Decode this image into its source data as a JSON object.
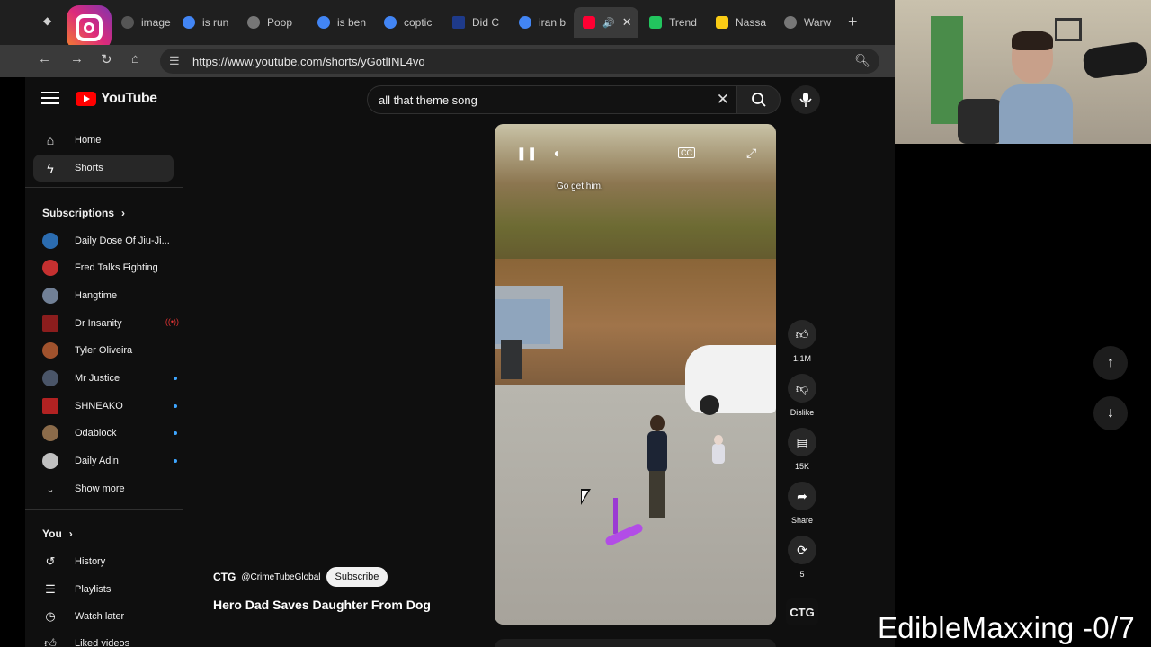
{
  "browser": {
    "tabs": [
      {
        "label": "image",
        "color": "#555555"
      },
      {
        "label": "is run",
        "color": "#4285f4"
      },
      {
        "label": "Poop",
        "color": "#777777"
      },
      {
        "label": "is ben",
        "color": "#4285f4"
      },
      {
        "label": "coptic",
        "color": "#4285f4"
      },
      {
        "label": "Did C",
        "color": "#1e3a8a"
      },
      {
        "label": "iran b",
        "color": "#4285f4"
      },
      {
        "label": "",
        "color": "#ff0033"
      },
      {
        "label": "Trend",
        "color": "#22c55e"
      },
      {
        "label": "Nassa",
        "color": "#facc15"
      },
      {
        "label": "Warw",
        "color": "#777777"
      }
    ],
    "new_tab_icon": "plus-icon",
    "url": "https://www.youtube.com/shorts/yGotlINL4vo"
  },
  "youtube": {
    "logo_text": "YouTube",
    "search_query": "all that theme song",
    "nav": [
      {
        "label": "Home",
        "icon": "home-icon"
      },
      {
        "label": "Shorts",
        "icon": "shorts-icon"
      }
    ],
    "subscriptions_heading": "Subscriptions",
    "subscriptions": [
      {
        "name": "Daily Dose Of Jiu-Ji...",
        "color": "#2b6cb0"
      },
      {
        "name": "Fred Talks Fighting",
        "color": "#c53030"
      },
      {
        "name": "Hangtime",
        "color": "#718096"
      },
      {
        "name": "Dr Insanity",
        "color": "#8b1d1d"
      },
      {
        "name": "Tyler Oliveira",
        "color": "#a0522d"
      },
      {
        "name": "Mr Justice",
        "color": "#4a5568"
      },
      {
        "name": "SHNEAKO",
        "color": "#b22222"
      },
      {
        "name": "Odablock",
        "color": "#8b6b4a"
      },
      {
        "name": "Daily Adin",
        "color": "#c0c0c0"
      }
    ],
    "show_more": "Show more",
    "you_heading": "You",
    "you_items": [
      {
        "label": "History",
        "icon": "history-icon"
      },
      {
        "label": "Playlists",
        "icon": "playlists-icon"
      },
      {
        "label": "Watch later",
        "icon": "clock-icon"
      },
      {
        "label": "Liked videos",
        "icon": "thumbs-up-icon"
      }
    ],
    "short": {
      "caption": "Go get him.",
      "channel_logo": "CTG",
      "channel_handle": "@CrimeTubeGlobal",
      "subscribe": "Subscribe",
      "title": "Hero Dad Saves Daughter From Dog",
      "likes": "1.1M",
      "dislike": "Dislike",
      "comments": "15K",
      "share": "Share",
      "remix": "5",
      "thumb_channel": "CTG"
    }
  },
  "overlay": {
    "text": "EdibleMaxxing -0/7"
  }
}
